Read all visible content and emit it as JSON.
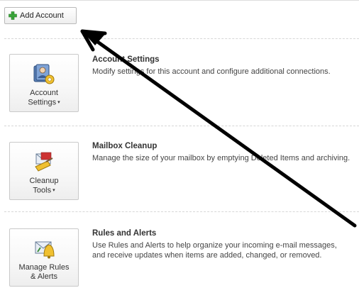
{
  "add_account": {
    "label": "Add Account",
    "icon": "green-plus-icon"
  },
  "sections": [
    {
      "id": "account-settings",
      "button_line1": "Account",
      "button_line2": "Settings",
      "has_dropdown": true,
      "icon": "account-settings-icon",
      "title": "Account Settings",
      "description": "Modify settings for this account and configure additional connections."
    },
    {
      "id": "mailbox-cleanup",
      "button_line1": "Cleanup",
      "button_line2": "Tools",
      "has_dropdown": true,
      "icon": "cleanup-tools-icon",
      "title": "Mailbox Cleanup",
      "description": "Manage the size of your mailbox by emptying Deleted Items and archiving."
    },
    {
      "id": "rules-and-alerts",
      "button_line1": "Manage Rules",
      "button_line2": "& Alerts",
      "has_dropdown": false,
      "icon": "rules-alerts-icon",
      "title": "Rules and Alerts",
      "description": "Use Rules and Alerts to help organize your incoming e-mail messages, and receive updates when items are added, changed, or removed."
    }
  ],
  "colors": {
    "arrow": "#000000",
    "plus_green": "#3aa63a",
    "divider": "#d6d6d6"
  }
}
